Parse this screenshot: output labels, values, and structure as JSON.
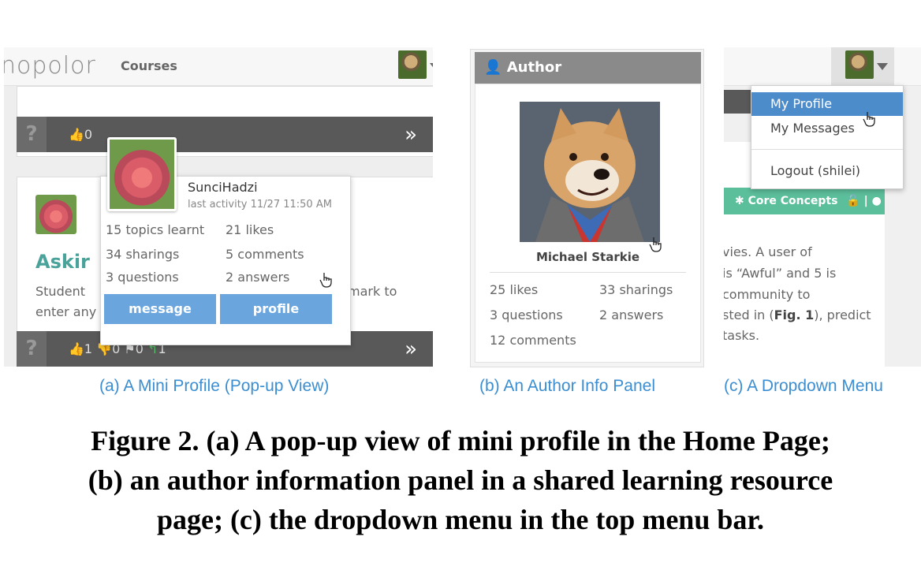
{
  "panel_a": {
    "logo": "nopolor",
    "nav_link": "Courses",
    "bar1": {
      "q": "?",
      "likes": "0",
      "chevron": "»"
    },
    "popup": {
      "name": "SunciHadzi",
      "activity": "last activity 11/27 11:50 AM",
      "stats": [
        "15 topics learnt",
        "21 likes",
        "34 sharings",
        "5 comments",
        "3 questions",
        "2 answers"
      ],
      "message_button": "message",
      "profile_button": "profile"
    },
    "card": {
      "title_partial": "Askir",
      "line1_start": "Student",
      "line1_end": "mark to",
      "line2": "enter any questions you have."
    },
    "bar2": {
      "q": "?",
      "likes": "1",
      "dislikes": "0",
      "flags": "0",
      "replies": "1",
      "chevron": "»"
    }
  },
  "panel_b": {
    "header": "Author",
    "author_name": "Michael Starkie",
    "stats": [
      "25 likes",
      "33 sharings",
      "3 questions",
      "2 answers",
      "12 comments"
    ]
  },
  "panel_c": {
    "menu": [
      "My Profile",
      "My Messages",
      "Logout (shilei)"
    ],
    "tag": "Core Concepts",
    "text_lines": [
      "vies. A user of",
      "is “Awful” and 5 is",
      "community to",
      "tasks."
    ],
    "line4_start": "sted in (",
    "line4_bold": "Fig. 1",
    "line4_end": "), predict"
  },
  "subcaptions": [
    "(a) A Mini Profile (Pop-up View)",
    "(b) An Author Info Panel",
    "(c) A Dropdown Menu"
  ],
  "figure_caption": [
    "Figure 2. (a) A pop-up view of mini profile in the Home Page;",
    "(b) an author information panel in a shared learning resource",
    "page; (c) the dropdown menu in the top menu bar."
  ],
  "colors": {
    "accent_blue": "#3b8ed1",
    "button_blue": "#6aa6dd",
    "menu_active": "#4d8ccb",
    "green_tag": "#5cbf9c",
    "teal_title": "#4aa39a"
  }
}
